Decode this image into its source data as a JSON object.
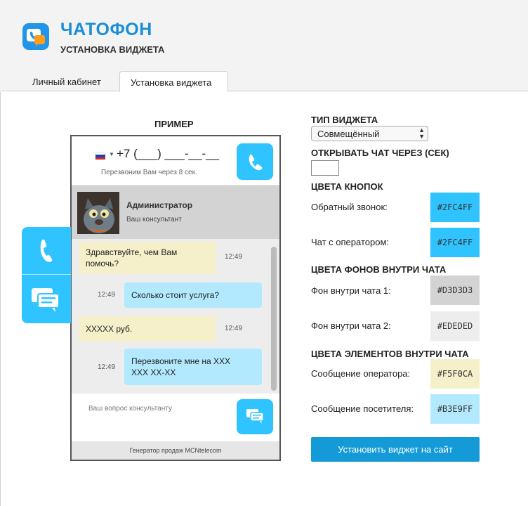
{
  "header": {
    "title": "ЧАТОФОН",
    "subtitle": "УСТАНОВКА ВИДЖЕТА",
    "logo_icon": "chat-phone-logo-icon"
  },
  "tabs": [
    {
      "label": "Личный кабинет",
      "active": false
    },
    {
      "label": "Установка виджета",
      "active": true
    }
  ],
  "preview": {
    "title": "ПРИМЕР",
    "callback": {
      "country_flag": "russia-flag-icon",
      "dropdown_arrow": "▼",
      "phone_mask": "+7 (___) ___-__-__",
      "note": "Перезвоним Вам через 8 сек.",
      "button_icon": "phone-icon"
    },
    "operator": {
      "name": "Администратор",
      "role": "Ваш консультант"
    },
    "messages": [
      {
        "from": "operator",
        "lines": [
          "Здравствуйте, чем Вам",
          "помочь?"
        ],
        "time": "12:49"
      },
      {
        "from": "visitor",
        "lines": [
          "Сколько стоит услуга?"
        ],
        "time": "12:49"
      },
      {
        "from": "operator",
        "lines": [
          "XXXXX руб."
        ],
        "time": "12:49"
      },
      {
        "from": "visitor",
        "lines": [
          "Перезвоните мне на XXX",
          "XXX XX-XX"
        ],
        "time": "12:49"
      }
    ],
    "input_placeholder": "Ваш вопрос консультанту",
    "footer": "Генератор продаж MCNtelecom",
    "colors": {
      "button": "#2FC4FF",
      "operator_bg": "#D3D3D3",
      "chat_bg": "#EDEDED",
      "op_msg": "#F5F0CA",
      "vis_msg": "#B3E9FF"
    }
  },
  "settings": {
    "widget_type": {
      "title": "ТИП ВИДЖЕТА",
      "selected": "Совмещённый"
    },
    "open_chat": {
      "title": "ОТКРЫВАТЬ ЧАТ ЧЕРЕЗ (СЕК)",
      "value": ""
    },
    "button_colors": {
      "title": "ЦВЕТА КНОПОК",
      "items": [
        {
          "label": "Обратный звонок:",
          "value": "#2FC4FF"
        },
        {
          "label": "Чат с оператором:",
          "value": "#2FC4FF"
        }
      ]
    },
    "bg_colors": {
      "title": "ЦВЕТА ФОНОВ ВНУТРИ ЧАТА",
      "items": [
        {
          "label": "Фон внутри чата 1:",
          "value": "#D3D3D3"
        },
        {
          "label": "Фон внутри чата 2:",
          "value": "#EDEDED"
        }
      ]
    },
    "element_colors": {
      "title": "ЦВЕТА ЭЛЕМЕНТОВ ВНУТРИ ЧАТА",
      "items": [
        {
          "label": "Сообщение оператора:",
          "value": "#F5F0CA"
        },
        {
          "label": "Сообщение посетителя:",
          "value": "#B3E9FF"
        }
      ]
    },
    "install_button": "Установить виджет на сайт"
  }
}
